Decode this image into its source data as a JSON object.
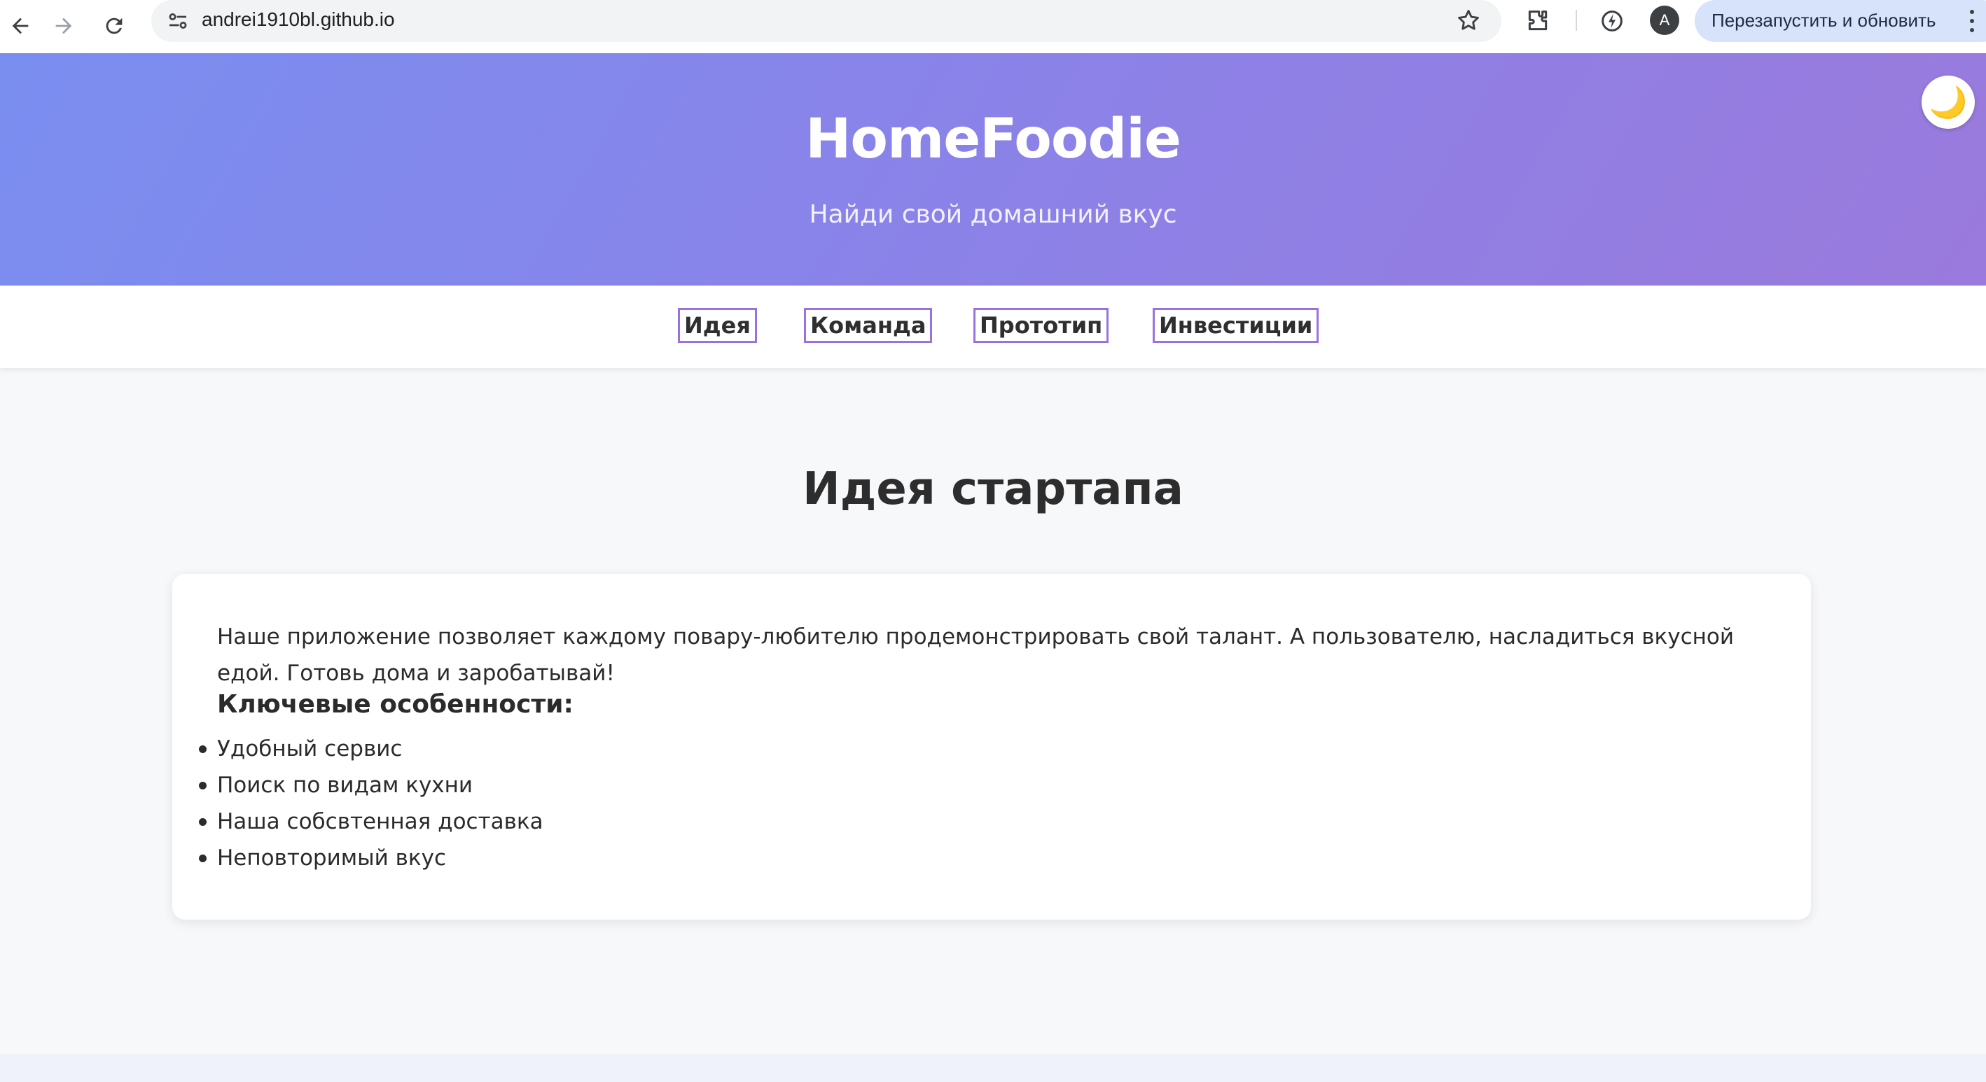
{
  "browser": {
    "url": "andrei1910bl.github.io",
    "avatar_letter": "A",
    "restart_label": "Перезапустить и обновить"
  },
  "hero": {
    "title": "HomeFoodie",
    "tagline": "Найди свой домашний вкус",
    "theme_toggle_icon": "🌙"
  },
  "nav": {
    "items": [
      {
        "label": "Идея"
      },
      {
        "label": "Команда"
      },
      {
        "label": "Прототип"
      },
      {
        "label": "Инвестиции"
      }
    ]
  },
  "section": {
    "title": "Идея стартапа",
    "description": "Наше приложение позволяет каждому повару-любителю продемонстрировать свой талант. А пользователю, насладиться вкусной едой. Готовь дома и заробатывай!",
    "features_title": "Ключевые особенности:",
    "features": [
      "Удобный сервис",
      "Поиск по видам кухни",
      "Наша собсвтенная доставка",
      "Неповторимый вкус"
    ]
  },
  "colors": {
    "hero_gradient_start": "#7a8ef0",
    "hero_gradient_end": "#9a7adc",
    "nav_border": "#9a72e0",
    "page_background": "#f7f8fa"
  }
}
